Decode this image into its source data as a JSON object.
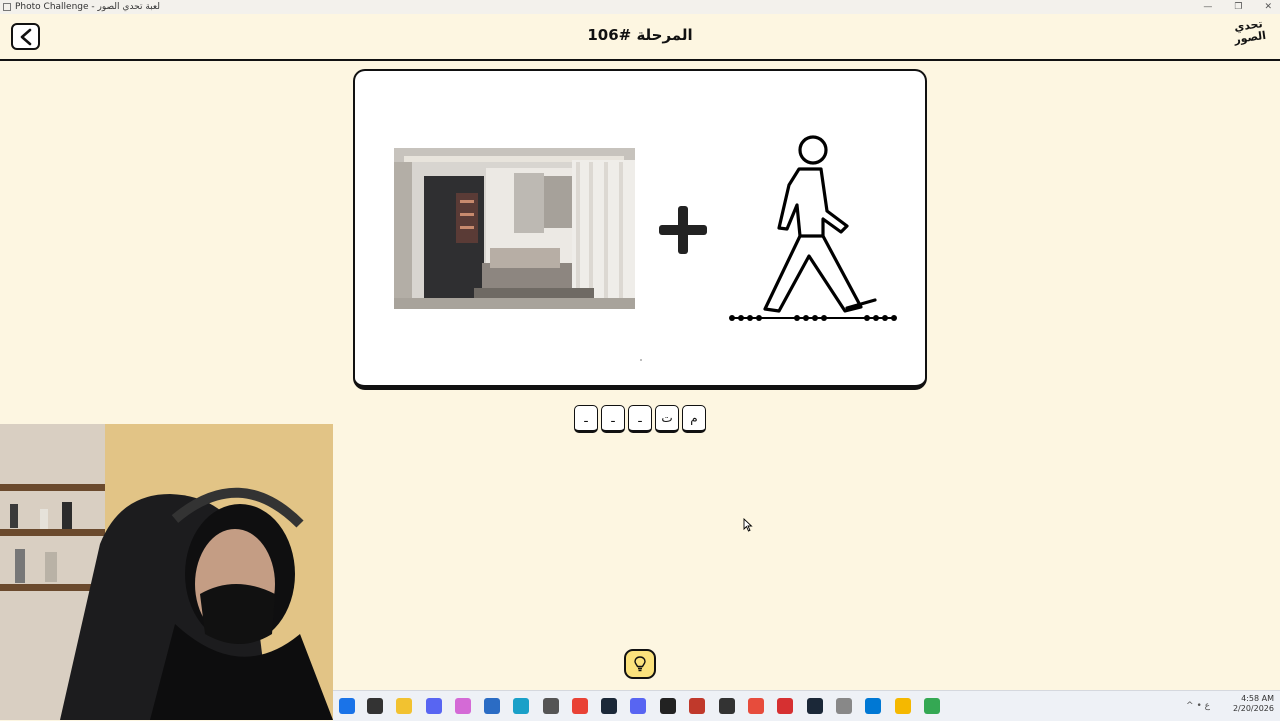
{
  "window": {
    "title": "Photo Challenge - لعبة تحدي الصور",
    "controls": [
      "—",
      "❐",
      "✕"
    ]
  },
  "header": {
    "level_title": "المرحلة #106",
    "logo_lines": [
      "تحدي",
      "الصور"
    ]
  },
  "puzzle": {
    "left_image": "bedroom-photo",
    "operator": "+",
    "right_image": "walking-person-icon"
  },
  "answer": {
    "slots": [
      "ـ",
      "ـ",
      "ـ",
      "ت",
      "م"
    ]
  },
  "hint": {
    "icon": "lightbulb-icon"
  },
  "taskbar": {
    "time": "4:58 AM",
    "date": "2/20/2026",
    "lang": "ع"
  },
  "colors": {
    "background": "#fdf6e1",
    "hint_button": "#fbe27d",
    "outline": "#111111"
  }
}
